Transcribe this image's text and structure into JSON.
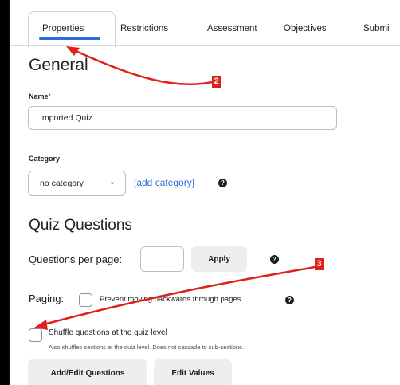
{
  "tabs": [
    {
      "label": "Properties",
      "active": true
    },
    {
      "label": "Restrictions"
    },
    {
      "label": "Assessment"
    },
    {
      "label": "Objectives"
    },
    {
      "label": "Submi"
    }
  ],
  "general": {
    "heading": "General",
    "name_label": "Name",
    "name_required_mark": "*",
    "name_value": "Imported Quiz",
    "category_label": "Category",
    "category_selected": "no category",
    "add_category_link": "[add category]"
  },
  "quiz_questions": {
    "heading": "Quiz Questions",
    "questions_per_page_label": "Questions per page:",
    "questions_per_page_value": "",
    "apply_button": "Apply",
    "paging_label": "Paging:",
    "paging_option": "Prevent moving backwards through pages",
    "paging_checked": false,
    "shuffle_label": "Shuffle questions at the quiz level",
    "shuffle_help": "Also shuffles sections at the quiz level. Does not cascade to sub-sections.",
    "shuffle_checked": false,
    "add_edit_button": "Add/Edit Questions",
    "edit_values_button": "Edit Values"
  },
  "annotations": {
    "badge_2": "2",
    "badge_3": "3",
    "accent_color": "#e0201c"
  },
  "colors": {
    "link": "#2a6ed9",
    "tab_underline": "#2a6ed9",
    "button_bg": "#eceef0"
  }
}
